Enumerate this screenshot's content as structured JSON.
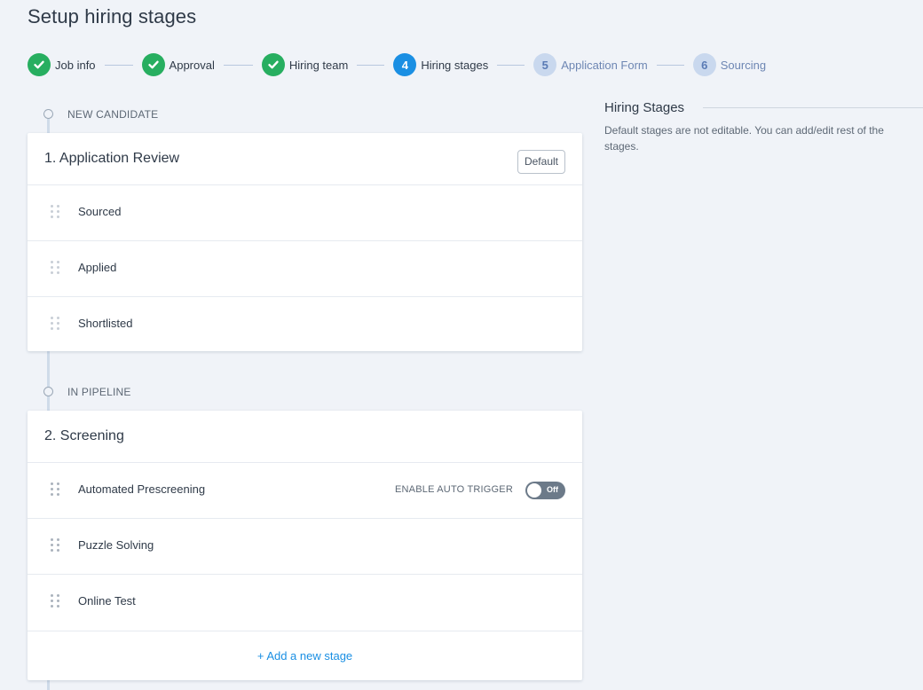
{
  "page": {
    "title": "Setup hiring stages"
  },
  "stepper": {
    "steps": [
      {
        "number": "1",
        "label": "Job info",
        "status": "done"
      },
      {
        "number": "2",
        "label": "Approval",
        "status": "done"
      },
      {
        "number": "3",
        "label": "Hiring team",
        "status": "done"
      },
      {
        "number": "4",
        "label": "Hiring stages",
        "status": "active"
      },
      {
        "number": "5",
        "label": "Application Form",
        "status": "pending"
      },
      {
        "number": "6",
        "label": "Sourcing",
        "status": "pending"
      }
    ],
    "colors": {
      "done": "#27ae60",
      "active": "#1a8fe3",
      "pending": "#c9d8ee"
    }
  },
  "sections": [
    {
      "label": "NEW CANDIDATE",
      "card": {
        "title": "1. Application Review",
        "badge": "Default",
        "stages": [
          "Sourced",
          "Applied",
          "Shortlisted"
        ]
      }
    },
    {
      "label": "IN PIPELINE",
      "card": {
        "title": "2. Screening",
        "stages": [
          "Automated Prescreening",
          "Puzzle Solving",
          "Online Test"
        ],
        "auto_trigger": {
          "label": "ENABLE AUTO TRIGGER",
          "toggle_text": "Off",
          "enabled": false
        },
        "add_stage": "+ Add a new stage"
      }
    }
  ],
  "side_panel": {
    "title": "Hiring Stages",
    "description": "Default stages are not editable. You can add/edit rest of the stages."
  }
}
